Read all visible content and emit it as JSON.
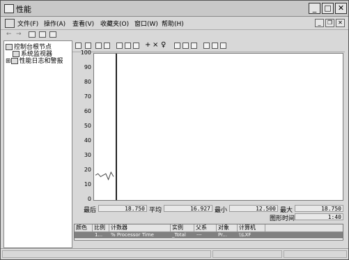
{
  "window": {
    "title": "性能",
    "buttons": {
      "minimize": "_",
      "maximize": "□",
      "close": "✕"
    }
  },
  "menu": {
    "items": [
      "文件(F)",
      "操作(A)",
      "查看(V)",
      "收藏夹(O)",
      "窗口(W)",
      "帮助(H)"
    ],
    "mdi": {
      "minimize": "_",
      "restore": "❐",
      "close": "✕"
    }
  },
  "tree": {
    "root": "控制台根节点",
    "children": [
      "系统监视器",
      "性能日志和警报"
    ],
    "expander": "⊞"
  },
  "graph": {
    "y_ticks": [
      "100",
      "90",
      "80",
      "70",
      "60",
      "50",
      "40",
      "30",
      "20",
      "10",
      "0"
    ]
  },
  "chart_data": {
    "type": "line",
    "ylim": [
      0,
      100
    ],
    "series": [
      {
        "name": "% Processor Time",
        "values": [
          17,
          18,
          16,
          17,
          18,
          14,
          19,
          16
        ]
      }
    ],
    "grid": false,
    "marker_position": 0.36
  },
  "stats": {
    "last_label": "最后",
    "last_value": "18.750",
    "avg_label": "平均",
    "avg_value": "16.927",
    "min_label": "最小",
    "min_value": "12.500",
    "max_label": "最大",
    "max_value": "18.750",
    "duration_label": "图形时间",
    "duration_value": "1:40"
  },
  "legend": {
    "headers": [
      "颜色",
      "比例",
      "计数器",
      "实例",
      "父系",
      "对象",
      "计算机"
    ],
    "row": {
      "scale": "1...",
      "counter": "% Processor Time",
      "instance": "_Total",
      "parent": "---",
      "object": "Pr...",
      "computer": "\\\\LXF"
    }
  },
  "colors": {
    "series_line": "#444444",
    "selected_row": "#808080"
  }
}
